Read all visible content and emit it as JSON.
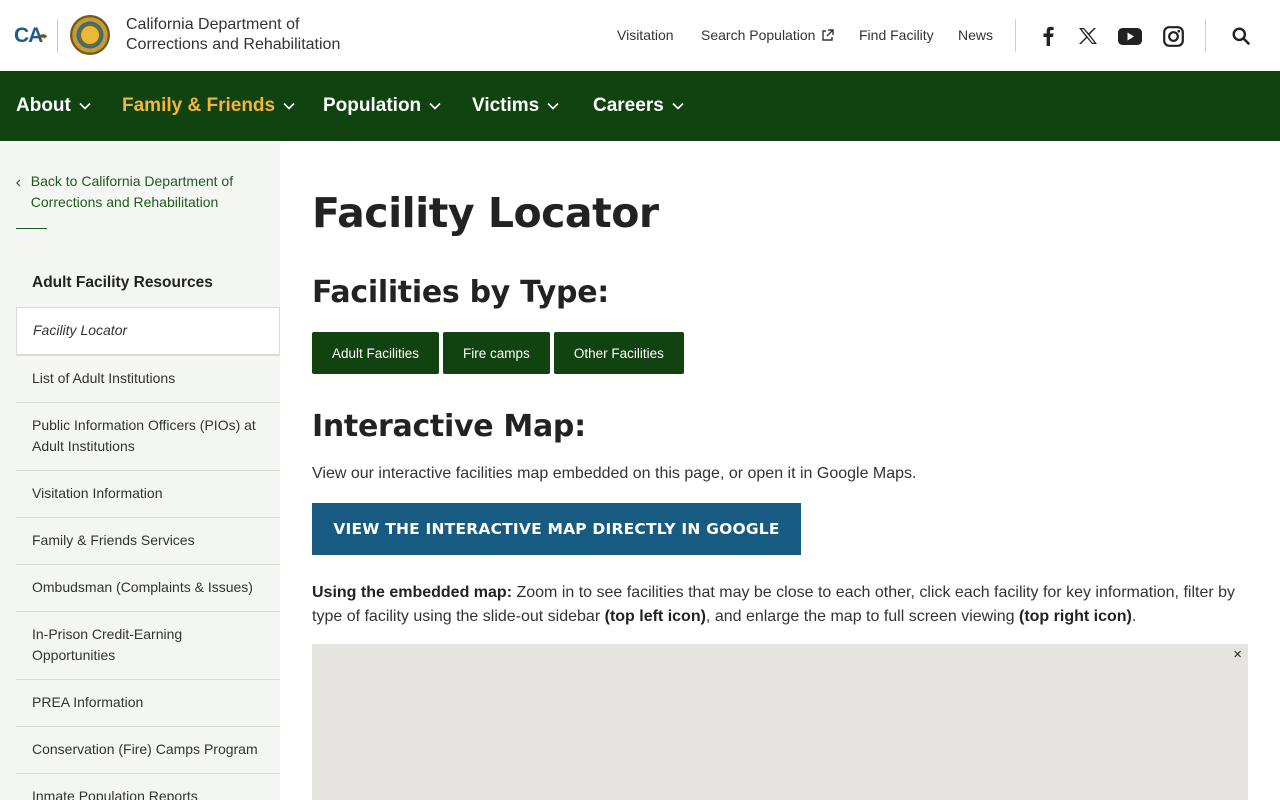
{
  "header": {
    "ca_logo_text": "CA",
    "department_name": "California Department of Corrections and Rehabilitation",
    "utility_links": {
      "visitation": "Visitation",
      "search_population": "Search Population",
      "find_facility": "Find Facility",
      "news": "News"
    },
    "social_icons": [
      "facebook-icon",
      "x-icon",
      "youtube-icon",
      "instagram-icon"
    ]
  },
  "main_nav": {
    "items": [
      {
        "label": "About",
        "active": false
      },
      {
        "label": "Family & Friends",
        "active": true
      },
      {
        "label": "Population",
        "active": false
      },
      {
        "label": "Victims",
        "active": false
      },
      {
        "label": "Careers",
        "active": false
      }
    ],
    "active_color": "#f5b43a"
  },
  "sidebar": {
    "back_label": "Back to California Department of Corrections and Rehabilitation",
    "heading": "Adult Facility Resources",
    "items": [
      {
        "label": "Facility Locator",
        "current": true
      },
      {
        "label": "List of Adult Institutions"
      },
      {
        "label": "Public Information Officers (PIOs) at Adult Institutions"
      },
      {
        "label": "Visitation Information"
      },
      {
        "label": "Family & Friends Services"
      },
      {
        "label": "Ombudsman (Complaints & Issues)"
      },
      {
        "label": "In-Prison Credit-Earning Opportunities"
      },
      {
        "label": "PREA Information"
      },
      {
        "label": "Conservation (Fire) Camps Program"
      },
      {
        "label": "Inmate Population Reports"
      }
    ]
  },
  "main": {
    "title": "Facility Locator",
    "types_heading": "Facilities by Type:",
    "type_buttons": [
      "Adult Facilities",
      "Fire camps",
      "Other Facilities"
    ],
    "map_heading": "Interactive Map:",
    "intro_text": "View our interactive facilities map embedded on this page, or open it in Google Maps.",
    "google_button": "VIEW THE INTERACTIVE MAP DIRECTLY IN GOOGLE",
    "usage": {
      "lead": "Using the embedded map:",
      "part1": " Zoom in to see facilities that may be close to each other, click each facility for key information, filter by type of facility using the slide-out sidebar ",
      "bold1": "(top left icon)",
      "part2": ", and enlarge the map to full screen viewing ",
      "bold2": "(top right icon)",
      "part3": "."
    },
    "map_close": "×"
  },
  "colors": {
    "nav_green": "#10430f",
    "button_blue": "#175b82",
    "sidebar_bg": "#f4f6f3"
  }
}
